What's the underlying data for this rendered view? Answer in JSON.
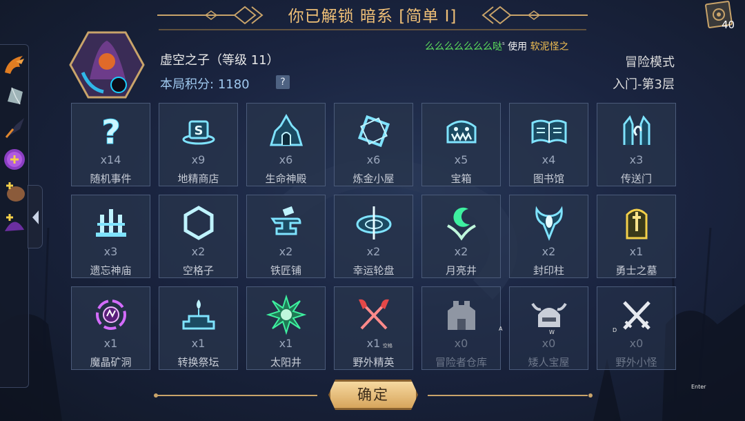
{
  "header": {
    "title": "你已解锁 暗系 [简单 I]"
  },
  "cards": {
    "count": "40",
    "icon": "card-deck-icon"
  },
  "sidebar": {
    "items": [
      {
        "icon": "orange-dragon-icon"
      },
      {
        "icon": "crystal-shard-icon"
      },
      {
        "icon": "dark-feather-icon"
      },
      {
        "icon": "purple-orb-plus-icon"
      },
      {
        "icon": "pet-plus-icon"
      },
      {
        "icon": "wizard-hat-key-icon"
      }
    ]
  },
  "player": {
    "name": "虚空之子（等级 11）",
    "score_label": "本局积分:",
    "score_value": "1180",
    "help": "?",
    "mode": "冒险模式",
    "floor": "入门-第3层"
  },
  "ticker": {
    "name": "么么么么么么么哒",
    "action": "使用",
    "item": "软泥怪之",
    "marker": "s"
  },
  "tiles": [
    {
      "count": "x14",
      "label": "随机事件",
      "icon": "question-mark-icon"
    },
    {
      "count": "x9",
      "label": "地精商店",
      "icon": "shop-hat-icon"
    },
    {
      "count": "x6",
      "label": "生命神殿",
      "icon": "life-temple-icon"
    },
    {
      "count": "x6",
      "label": "炼金小屋",
      "icon": "alchemy-hut-icon"
    },
    {
      "count": "x5",
      "label": "宝箱",
      "icon": "treasure-chest-icon"
    },
    {
      "count": "x4",
      "label": "图书馆",
      "icon": "library-book-icon"
    },
    {
      "count": "x3",
      "label": "传送门",
      "icon": "portal-icon"
    },
    {
      "count": "x3",
      "label": "遗忘神庙",
      "icon": "forgotten-temple-icon"
    },
    {
      "count": "x2",
      "label": "空格子",
      "icon": "empty-hexagon-icon"
    },
    {
      "count": "x2",
      "label": "铁匠铺",
      "icon": "anvil-icon"
    },
    {
      "count": "x2",
      "label": "幸运轮盘",
      "icon": "lucky-wheel-icon"
    },
    {
      "count": "x2",
      "label": "月亮井",
      "icon": "moon-well-icon"
    },
    {
      "count": "x2",
      "label": "封印柱",
      "icon": "seal-pillar-icon"
    },
    {
      "count": "x1",
      "label": "勇士之墓",
      "icon": "warrior-tomb-icon"
    },
    {
      "count": "x1",
      "label": "魔晶矿洞",
      "icon": "magic-crystal-mine-icon"
    },
    {
      "count": "x1",
      "label": "转换祭坛",
      "icon": "conversion-altar-icon"
    },
    {
      "count": "x1",
      "label": "太阳井",
      "icon": "sun-well-icon"
    },
    {
      "count": "x1",
      "label": "野外精英",
      "icon": "crossed-axes-icon",
      "note": "空格"
    },
    {
      "count": "x0",
      "label": "冒险者仓库",
      "icon": "adventurer-warehouse-icon"
    },
    {
      "count": "x0",
      "label": "矮人宝屋",
      "icon": "dwarf-helmet-icon"
    },
    {
      "count": "x0",
      "label": "野外小怪",
      "icon": "crossed-swords-icon"
    }
  ],
  "confirm": {
    "label": "确定"
  },
  "marks": {
    "a": "A",
    "w": "W",
    "d": "D",
    "enter": "Enter"
  },
  "colors": {
    "title": "#f0c077",
    "icon_glow": "#7fe3ff",
    "green_icon": "#3ef0a0",
    "purple_icon": "#d46cff",
    "gold_icon": "#f3d04a",
    "score": "#9fc8ee"
  }
}
